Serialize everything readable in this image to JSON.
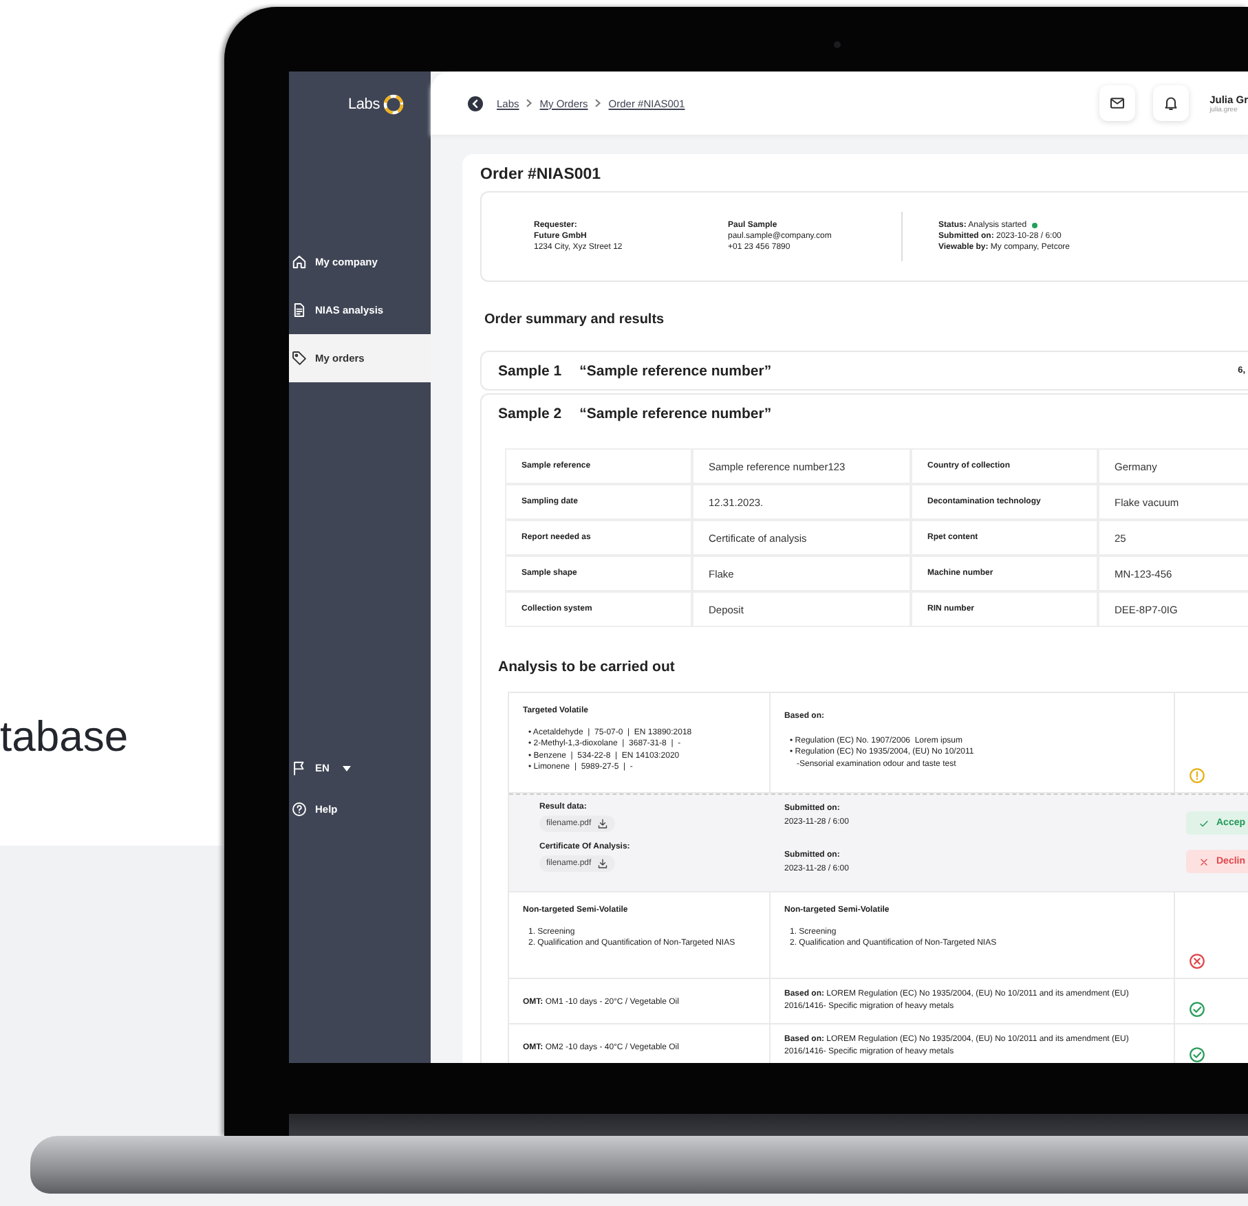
{
  "backdrop": {
    "heading_fragment": "tabase"
  },
  "sidebar": {
    "logo": "Labs",
    "items": [
      {
        "label": "My company",
        "selected": false
      },
      {
        "label": "NIAS analysis",
        "selected": false
      },
      {
        "label": "My orders",
        "selected": true
      }
    ],
    "language": "EN",
    "help": "Help"
  },
  "header": {
    "breadcrumb": [
      "Labs",
      "My Orders",
      "Order #NIAS001"
    ],
    "user": {
      "name": "Julia Gr",
      "email": "julia.gree"
    }
  },
  "order": {
    "title": "Order #NIAS001",
    "requester": {
      "label": "Requester:",
      "company": "Future GmbH",
      "address": "1234 City, Xyz Street 12"
    },
    "contact": {
      "name": "Paul Sample",
      "email": "paul.sample@company.com",
      "phone": "+01 23 456 7890"
    },
    "status": [
      "**Status:** Analysis started",
      "**Submitted on:** 2023-10-28 / 6:00",
      "**Viewable by:** My company, Petcore"
    ]
  },
  "summary_title": "Order summary and results",
  "samples": [
    {
      "number": "Sample 1",
      "reference": "“Sample reference number”",
      "expanded": false,
      "note": "6,"
    },
    {
      "number": "Sample 2",
      "reference": "“Sample reference number”",
      "expanded": true
    }
  ],
  "details": [
    {
      "label_1": "Sample reference",
      "value_1": "Sample reference number123",
      "label_2": "Country of collection",
      "value_2": "Germany"
    },
    {
      "label_1": "Sampling date",
      "value_1": "12.31.2023.",
      "label_2": "Decontamination technology",
      "value_2": "Flake vacuum"
    },
    {
      "label_1": "Report needed as",
      "value_1": "Certificate of analysis",
      "label_2": "Rpet content",
      "value_2": "25"
    },
    {
      "label_1": "Sample shape",
      "value_1": "Flake",
      "label_2": "Machine number",
      "value_2": "MN-123-456"
    },
    {
      "label_1": "Collection system",
      "value_1": "Deposit",
      "label_2": "RIN number",
      "value_2": "DEE-8P7-0IG"
    }
  ],
  "analysis": {
    "title": "Analysis to be carried out",
    "groups": [
      {
        "kind": "bullets",
        "title": "Targeted Volatile",
        "items": [
          "• Acetaldehyde  |  75-07-0  |  EN 13890:2018",
          "• 2-Methyl-1,3-dioxolane  |  3687-31-8  |  -",
          "• Benzene  |  534-22-8  |  EN 14103:2020",
          "• Limonene  |  5989-27-5  |  -"
        ],
        "based_on_label": "Based on:",
        "based_on": [
          "• Regulation (EC) No. 1907/2006  Lorem ipsum",
          "• Regulation (EC) No 1935/2004, (EU) No 10/2011"
        ],
        "based_on_note": "-Sensorial examination odour and taste test",
        "result": {
          "kind": "warning"
        }
      },
      {
        "kind": "results",
        "results": [
          {
            "label": "Result data:",
            "file": "filename.pdf",
            "submitted_label": "Submitted on:",
            "submitted": "2023-11-28 / 6:00"
          },
          {
            "label": "Certificate Of Analysis:",
            "file": "filename.pdf",
            "submitted_label": "Submitted on:",
            "submitted": "2023-11-28 / 6:00"
          }
        ],
        "actions": [
          {
            "kind": "accept",
            "label": "Accep"
          },
          {
            "kind": "decline",
            "label": "Declin"
          }
        ]
      },
      {
        "kind": "numbered",
        "left_title": "Non-targeted Semi-Volatile",
        "left_items": [
          "1. Screening",
          "2. Qualification and Quantification of Non-Targeted NIAS"
        ],
        "right_title": "Non-targeted Semi-Volatile",
        "right_items": [
          "1. Screening",
          "2. Qualification and Quantification of Non-Targeted NIAS"
        ],
        "result": {
          "kind": "rejected"
        }
      },
      {
        "kind": "omt",
        "method": "**OMT:** OM1 -10 days - 20°C / Vegetable Oil",
        "basis": "**Based on:** LOREM Regulation (EC) No 1935/2004, (EU) No 10/2011 and its amendment (EU) 2016/1416- Specific migration of heavy metals",
        "result": {
          "kind": "approved"
        }
      },
      {
        "kind": "omt",
        "method": "**OMT:** OM2 -10 days - 40°C / Vegetable Oil",
        "basis": "**Based on:** LOREM Regulation (EC) No 1935/2004, (EU) No 10/2011 and its amendment (EU) 2016/1416- Specific migration of heavy metals",
        "result": {
          "kind": "approved"
        }
      }
    ]
  }
}
